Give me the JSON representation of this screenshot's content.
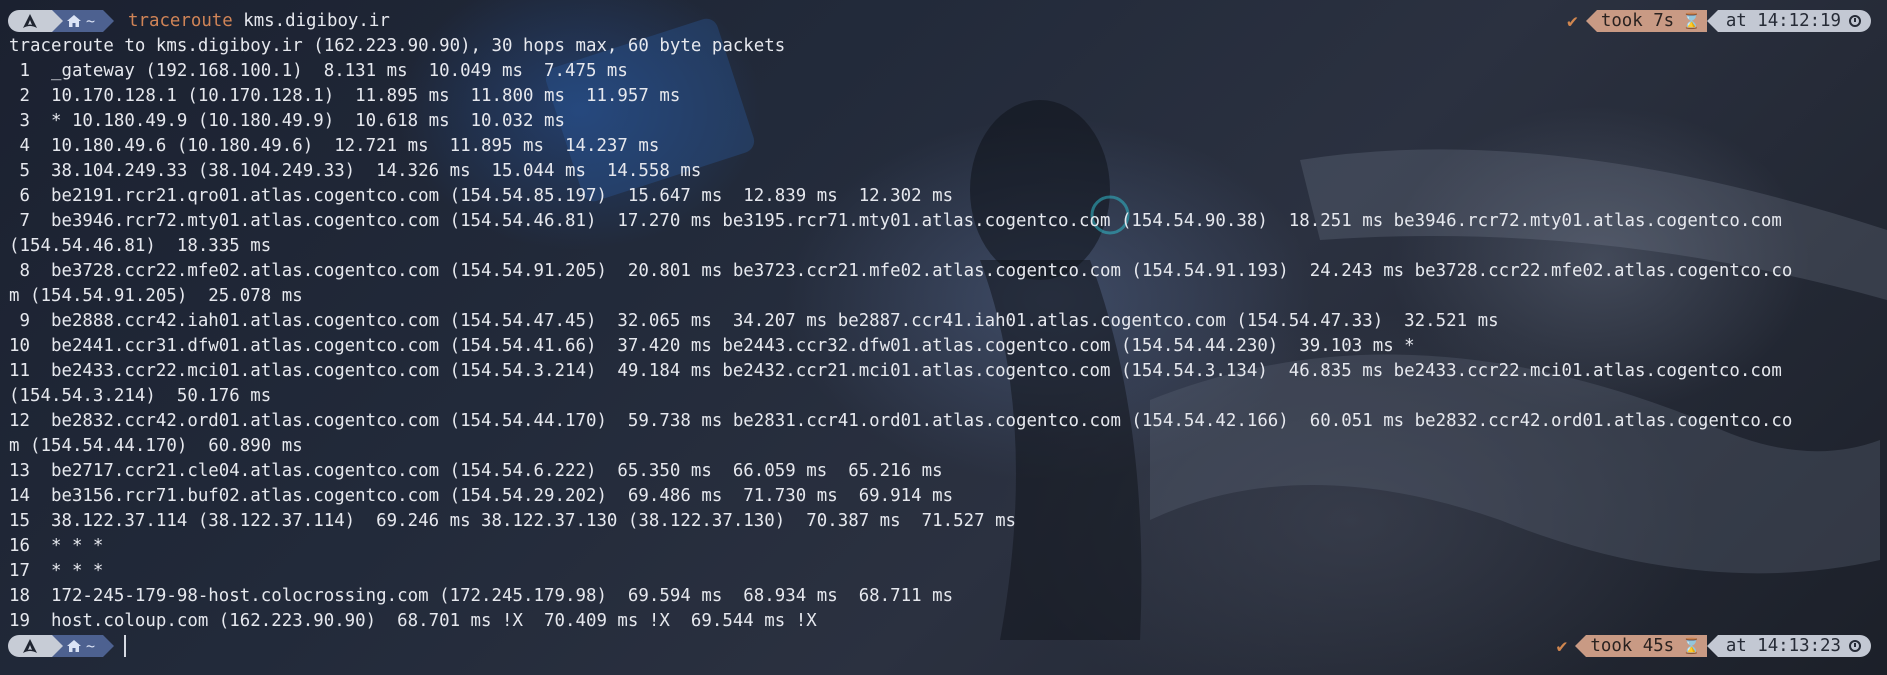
{
  "prompt_top": {
    "os_icon": "arch-icon",
    "home_icon": "home-icon",
    "dir": "~",
    "command_name": "traceroute",
    "command_arg": "kms.digiboy.ir",
    "status_icon": "check-icon",
    "took": "took 7s",
    "time": "at 14:12:19"
  },
  "output_lines": [
    "traceroute to kms.digiboy.ir (162.223.90.90), 30 hops max, 60 byte packets",
    " 1  _gateway (192.168.100.1)  8.131 ms  10.049 ms  7.475 ms",
    " 2  10.170.128.1 (10.170.128.1)  11.895 ms  11.800 ms  11.957 ms",
    " 3  * 10.180.49.9 (10.180.49.9)  10.618 ms  10.032 ms",
    " 4  10.180.49.6 (10.180.49.6)  12.721 ms  11.895 ms  14.237 ms",
    " 5  38.104.249.33 (38.104.249.33)  14.326 ms  15.044 ms  14.558 ms",
    " 6  be2191.rcr21.qro01.atlas.cogentco.com (154.54.85.197)  15.647 ms  12.839 ms  12.302 ms",
    " 7  be3946.rcr72.mty01.atlas.cogentco.com (154.54.46.81)  17.270 ms be3195.rcr71.mty01.atlas.cogentco.com (154.54.90.38)  18.251 ms be3946.rcr72.mty01.atlas.cogentco.com",
    "(154.54.46.81)  18.335 ms",
    " 8  be3728.ccr22.mfe02.atlas.cogentco.com (154.54.91.205)  20.801 ms be3723.ccr21.mfe02.atlas.cogentco.com (154.54.91.193)  24.243 ms be3728.ccr22.mfe02.atlas.cogentco.co",
    "m (154.54.91.205)  25.078 ms",
    " 9  be2888.ccr42.iah01.atlas.cogentco.com (154.54.47.45)  32.065 ms  34.207 ms be2887.ccr41.iah01.atlas.cogentco.com (154.54.47.33)  32.521 ms",
    "10  be2441.ccr31.dfw01.atlas.cogentco.com (154.54.41.66)  37.420 ms be2443.ccr32.dfw01.atlas.cogentco.com (154.54.44.230)  39.103 ms *",
    "11  be2433.ccr22.mci01.atlas.cogentco.com (154.54.3.214)  49.184 ms be2432.ccr21.mci01.atlas.cogentco.com (154.54.3.134)  46.835 ms be2433.ccr22.mci01.atlas.cogentco.com",
    "(154.54.3.214)  50.176 ms",
    "12  be2832.ccr42.ord01.atlas.cogentco.com (154.54.44.170)  59.738 ms be2831.ccr41.ord01.atlas.cogentco.com (154.54.42.166)  60.051 ms be2832.ccr42.ord01.atlas.cogentco.co",
    "m (154.54.44.170)  60.890 ms",
    "13  be2717.ccr21.cle04.atlas.cogentco.com (154.54.6.222)  65.350 ms  66.059 ms  65.216 ms",
    "14  be3156.rcr71.buf02.atlas.cogentco.com (154.54.29.202)  69.486 ms  71.730 ms  69.914 ms",
    "15  38.122.37.114 (38.122.37.114)  69.246 ms 38.122.37.130 (38.122.37.130)  70.387 ms  71.527 ms",
    "16  * * *",
    "17  * * *",
    "18  172-245-179-98-host.colocrossing.com (172.245.179.98)  69.594 ms  68.934 ms  68.711 ms",
    "19  host.coloup.com (162.223.90.90)  68.701 ms !X  70.409 ms !X  69.544 ms !X"
  ],
  "prompt_bottom": {
    "os_icon": "arch-icon",
    "home_icon": "home-icon",
    "dir": "~",
    "status_icon": "check-icon",
    "took": "took 45s",
    "time": "at 14:13:23"
  },
  "colors": {
    "command": "#d08457",
    "took_bg": "#c99a84",
    "time_bg": "#c3c8d3",
    "home_bg": "#4d6190",
    "os_bg": "#c7ccd6"
  }
}
